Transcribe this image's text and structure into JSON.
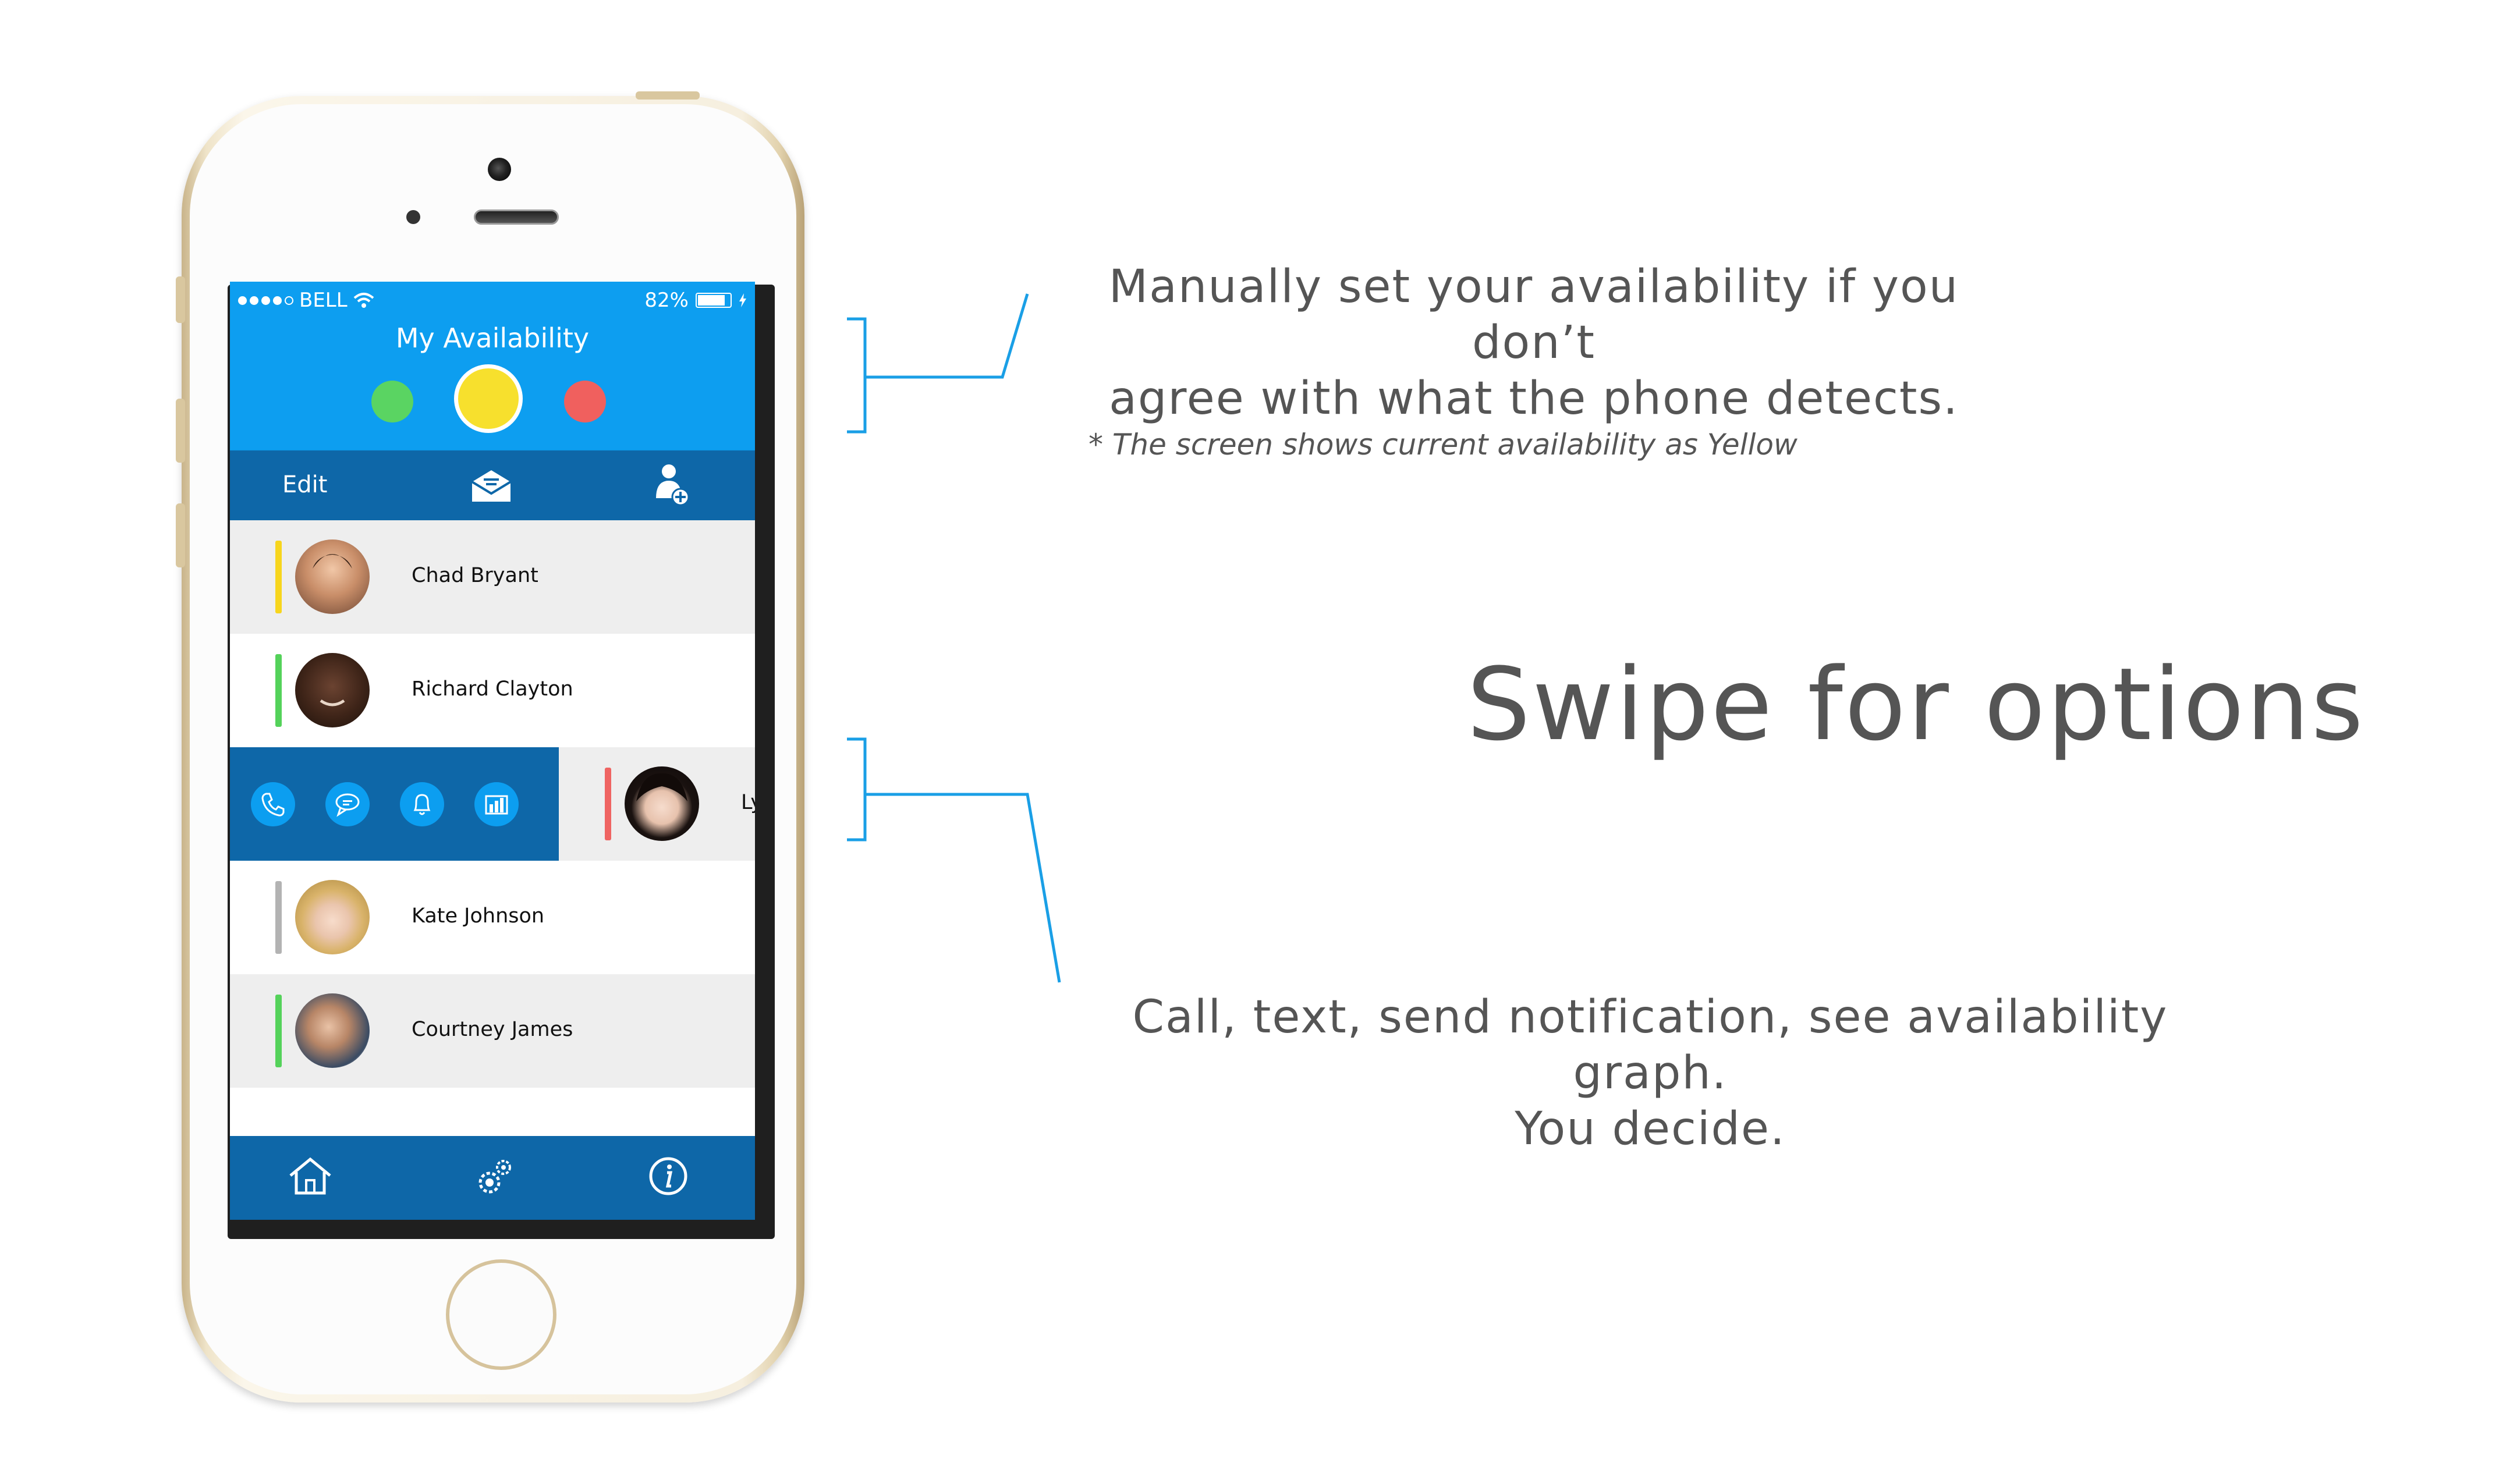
{
  "status_bar": {
    "carrier": "BELL",
    "battery": "82%"
  },
  "header": {
    "title": "My Availability",
    "statuses": [
      {
        "name": "green",
        "color": "#5ad462"
      },
      {
        "name": "yellow",
        "color": "#f7e02d",
        "selected": true
      },
      {
        "name": "red",
        "color": "#f0605e"
      }
    ]
  },
  "toolbar": {
    "edit_label": "Edit",
    "message_icon": "envelope-icon",
    "add_contact_icon": "add-person-icon"
  },
  "contacts": [
    {
      "name": "Chad Bryant",
      "status_color": "#f7d51d"
    },
    {
      "name": "Richard Clayton",
      "status_color": "#54d25a"
    },
    {
      "name": "Ly",
      "status_color": "#ef6462"
    },
    {
      "name": "Kate Johnson",
      "status_color": "#b3b3b3"
    },
    {
      "name": "Courtney James",
      "status_color": "#54d25a"
    }
  ],
  "swipe_actions": [
    "phone-icon",
    "chat-icon",
    "bell-icon",
    "bar-chart-icon"
  ],
  "tabbar": [
    "home-icon",
    "settings-icon",
    "info-icon"
  ],
  "annotations": {
    "availability_line1": "Manually set your availability if you don’t",
    "availability_line2": "agree with what the phone detects.",
    "note": "* The screen shows current availability as Yellow",
    "headline": "Swipe for options",
    "options_line1": "Call, text, send notification, see availability graph.",
    "options_line2": "You decide."
  },
  "colors": {
    "header_blue": "#0d9ef0",
    "dark_blue": "#0e67a8",
    "annotation_line": "#1a9fe6",
    "annotation_text": "#555555"
  }
}
